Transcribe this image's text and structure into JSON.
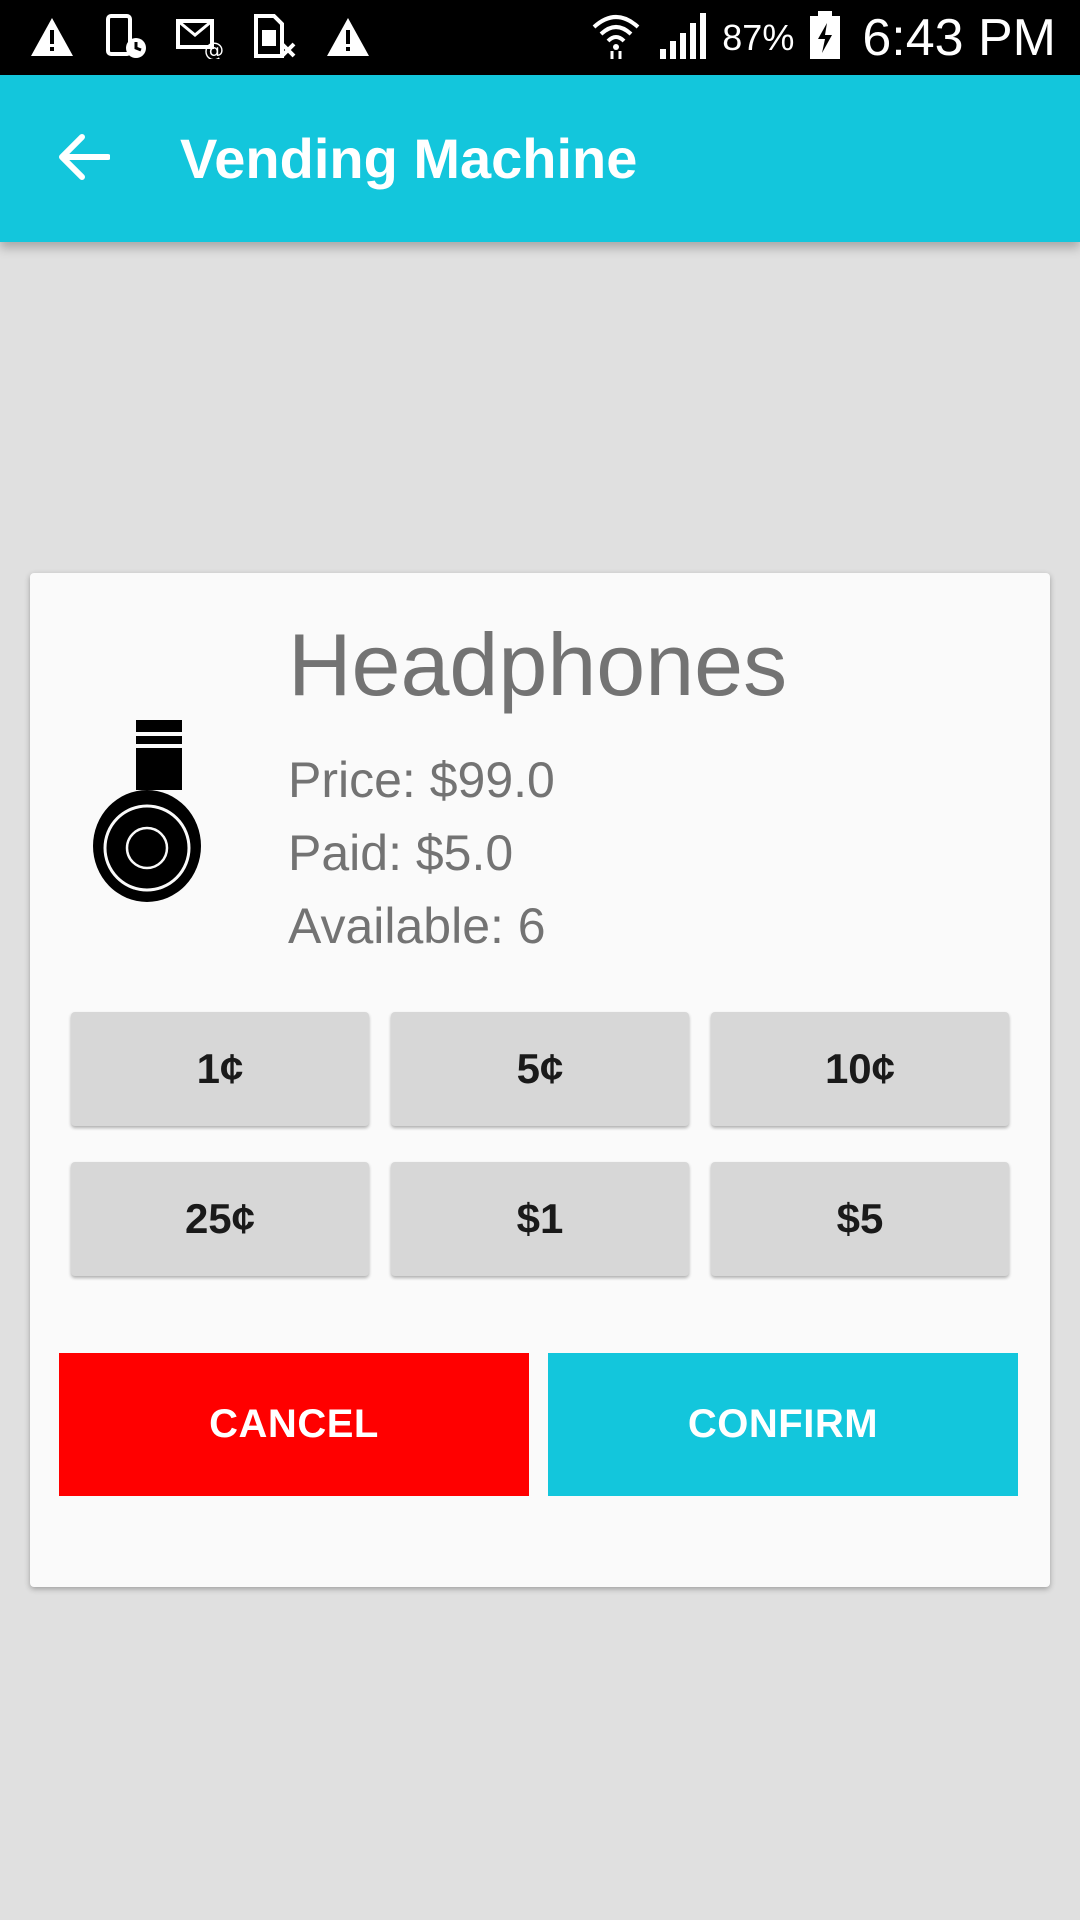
{
  "status_bar": {
    "left_icons": [
      "warning-icon",
      "device-clock-icon",
      "email-icon",
      "sim-error-icon",
      "warning-icon"
    ],
    "right_icons": [
      "wifi-icon",
      "signal-icon",
      "battery-charging-icon"
    ],
    "battery_percent": "87%",
    "time": "6:43 PM"
  },
  "app_bar": {
    "back_icon": "arrow-back-icon",
    "title": "Vending Machine",
    "color": "#13c6dc"
  },
  "product": {
    "icon": "headphones-icon",
    "name": "Headphones",
    "price": "Price: $99.0",
    "paid": "Paid: $5.0",
    "available": "Available: 6"
  },
  "coins": [
    "1¢",
    "5¢",
    "10¢",
    "25¢",
    "$1",
    "$5"
  ],
  "actions": {
    "cancel": "CANCEL",
    "confirm": "CONFIRM",
    "cancel_color": "#ff0000",
    "confirm_color": "#13c6dc"
  }
}
